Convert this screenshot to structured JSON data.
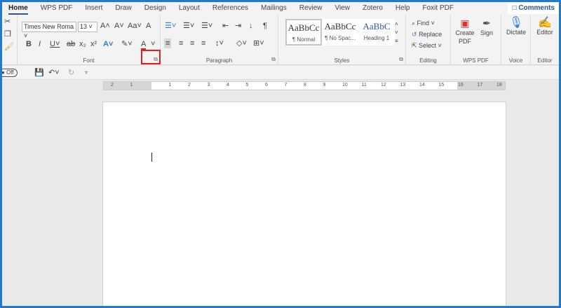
{
  "tabs": [
    "Home",
    "WPS PDF",
    "Insert",
    "Draw",
    "Design",
    "Layout",
    "References",
    "Mailings",
    "Review",
    "View",
    "Zotero",
    "Help",
    "Foxit PDF"
  ],
  "comments_label": "Comments",
  "font": {
    "name": "Times New Roma",
    "size": "13",
    "group_label": "Font"
  },
  "paragraph": {
    "group_label": "Paragraph"
  },
  "styles": {
    "items": [
      {
        "preview": "AaBbCc",
        "name": "¶ Normal"
      },
      {
        "preview": "AaBbCc",
        "name": "¶ No Spac..."
      },
      {
        "preview": "AaBbC",
        "name": "Heading 1"
      }
    ],
    "group_label": "Styles"
  },
  "editing": {
    "find": "Find",
    "replace": "Replace",
    "select": "Select",
    "group_label": "Editing"
  },
  "wps": {
    "create": "Create PDF",
    "sign": "Sign",
    "group_label": "WPS PDF"
  },
  "voice": {
    "dictate": "Dictate",
    "group_label": "Voice"
  },
  "editor": {
    "label": "Editor",
    "group_label": "Editor"
  },
  "qat": {
    "autosave_state": "Off"
  },
  "ruler": [
    "2",
    "1",
    "1",
    "2",
    "3",
    "4",
    "5",
    "6",
    "7",
    "8",
    "9",
    "10",
    "11",
    "12",
    "13",
    "14",
    "15",
    "16",
    "17",
    "18"
  ],
  "colors": {
    "accent": "#2b5797",
    "border": "#1f7ad0",
    "highlight": "#e02020"
  }
}
